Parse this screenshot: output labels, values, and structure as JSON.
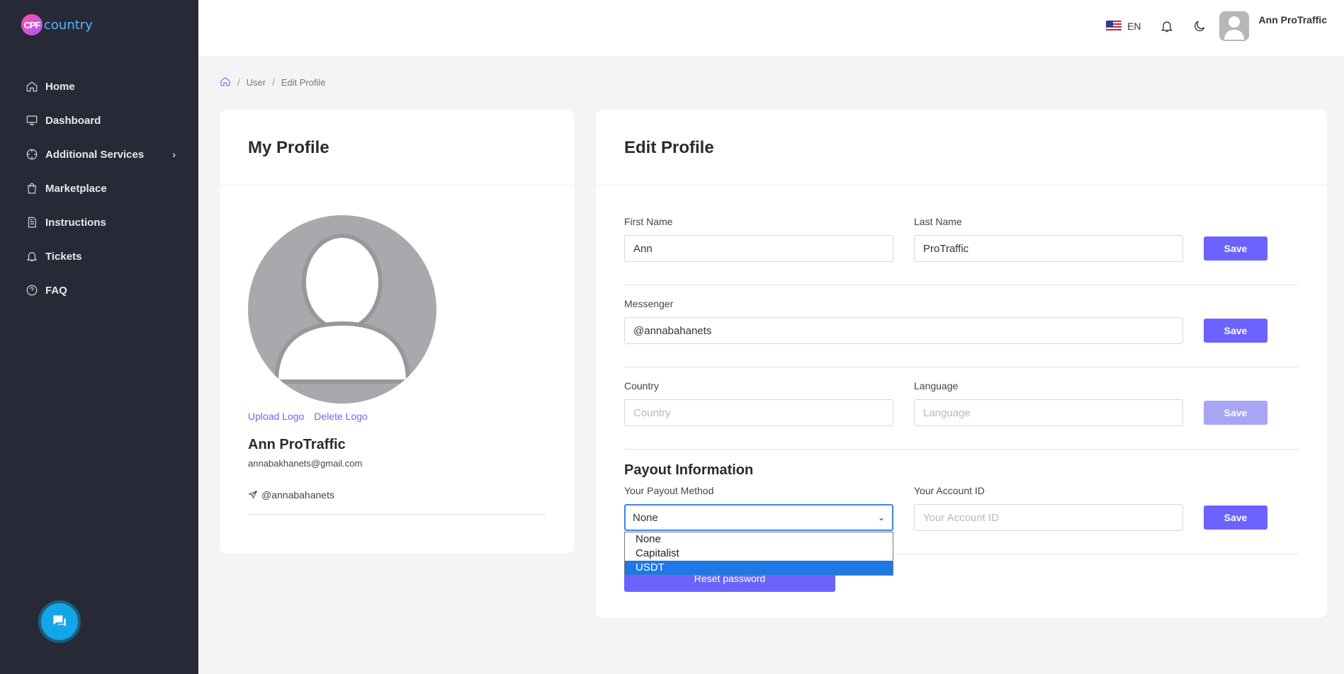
{
  "app": {
    "logo_mark": "CPF",
    "logo_text": "country"
  },
  "sidebar": {
    "items": [
      {
        "label": "Home",
        "icon": "home-icon"
      },
      {
        "label": "Dashboard",
        "icon": "monitor-icon"
      },
      {
        "label": "Additional Services",
        "icon": "crosshair-icon"
      },
      {
        "label": "Marketplace",
        "icon": "shopping-bag-icon"
      },
      {
        "label": "Instructions",
        "icon": "document-icon"
      },
      {
        "label": "Tickets",
        "icon": "bell-icon"
      },
      {
        "label": "FAQ",
        "icon": "help-circle-icon"
      }
    ]
  },
  "header": {
    "language": "EN",
    "user_name": "Ann ProTraffic"
  },
  "breadcrumb": {
    "items": [
      "User",
      "Edit Profile"
    ]
  },
  "profile": {
    "title": "My Profile",
    "upload_logo": "Upload Logo",
    "delete_logo": "Delete Logo",
    "name": "Ann ProTraffic",
    "email": "annabakhanets@gmail.com",
    "messenger": "@annabahanets"
  },
  "edit": {
    "title": "Edit Profile",
    "first_name": {
      "label": "First Name",
      "value": "Ann"
    },
    "last_name": {
      "label": "Last Name",
      "value": "ProTraffic"
    },
    "messenger": {
      "label": "Messenger",
      "value": "@annabahanets"
    },
    "country": {
      "label": "Country",
      "placeholder": "Country"
    },
    "language": {
      "label": "Language",
      "placeholder": "Language"
    },
    "payout_title": "Payout Information",
    "payout_method": {
      "label": "Your Payout Method",
      "selected": "None",
      "options": [
        "None",
        "Capitalist",
        "USDT"
      ],
      "highlighted": "USDT"
    },
    "account_id": {
      "label": "Your Account ID",
      "placeholder": "Your Account ID"
    },
    "save_label": "Save",
    "reset_label": "Reset password"
  },
  "colors": {
    "sidebar_bg": "#272a36",
    "accent": "#6c63ff",
    "chat_button": "#12a6e8",
    "dropdown_highlight": "#1e78e6"
  }
}
